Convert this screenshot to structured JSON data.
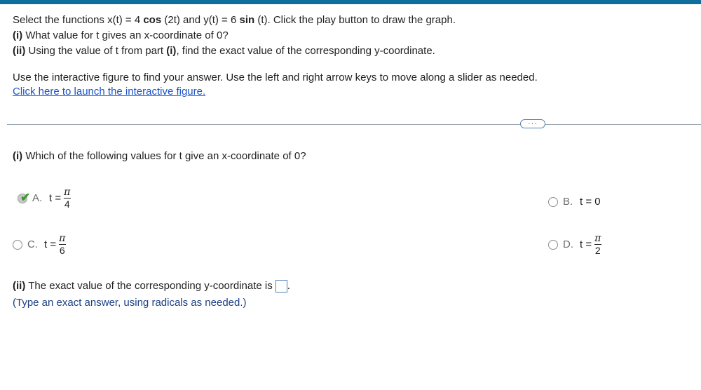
{
  "question": {
    "line1_prefix": "Select the functions x(t) = 4 ",
    "line1_cos": "cos",
    "line1_mid": " (2t) and y(t) = 6 ",
    "line1_sin": "sin",
    "line1_suffix": " (t). Click the play button to draw the graph.",
    "part_i_label": "(i)",
    "part_i_text": " What value for t gives an x-coordinate of 0?",
    "part_ii_label": "(ii)",
    "part_ii_text_a": " Using the value of t from part ",
    "part_ii_ref": "(i)",
    "part_ii_text_b": ", find the exact value of the corresponding y-coordinate.",
    "instructions": "Use the interactive figure to find your answer. Use the left and right arrow keys to move along a slider as needed.",
    "launch_link": "Click here to launch the interactive figure."
  },
  "more_button": "···",
  "part_i": {
    "label": "(i)",
    "text": " Which of the following values for t give an x-coordinate of 0?"
  },
  "options": [
    {
      "letter": "A.",
      "t": "t =",
      "num": "π",
      "den": "4",
      "selected": true
    },
    {
      "letter": "B.",
      "t": "t = 0",
      "selected": false
    },
    {
      "letter": "C.",
      "t": "t =",
      "num": "π",
      "den": "6",
      "selected": false
    },
    {
      "letter": "D.",
      "t": "t =",
      "num": "π",
      "den": "2",
      "selected": false
    }
  ],
  "part_ii": {
    "label": "(ii)",
    "text": " The exact value of the corresponding y-coordinate is",
    "period": ".",
    "hint": "(Type an exact answer, using radicals as needed.)"
  },
  "colors": {
    "accent": "#0f6f9a",
    "link": "#1a55c9",
    "check": "#3a9a2a"
  }
}
